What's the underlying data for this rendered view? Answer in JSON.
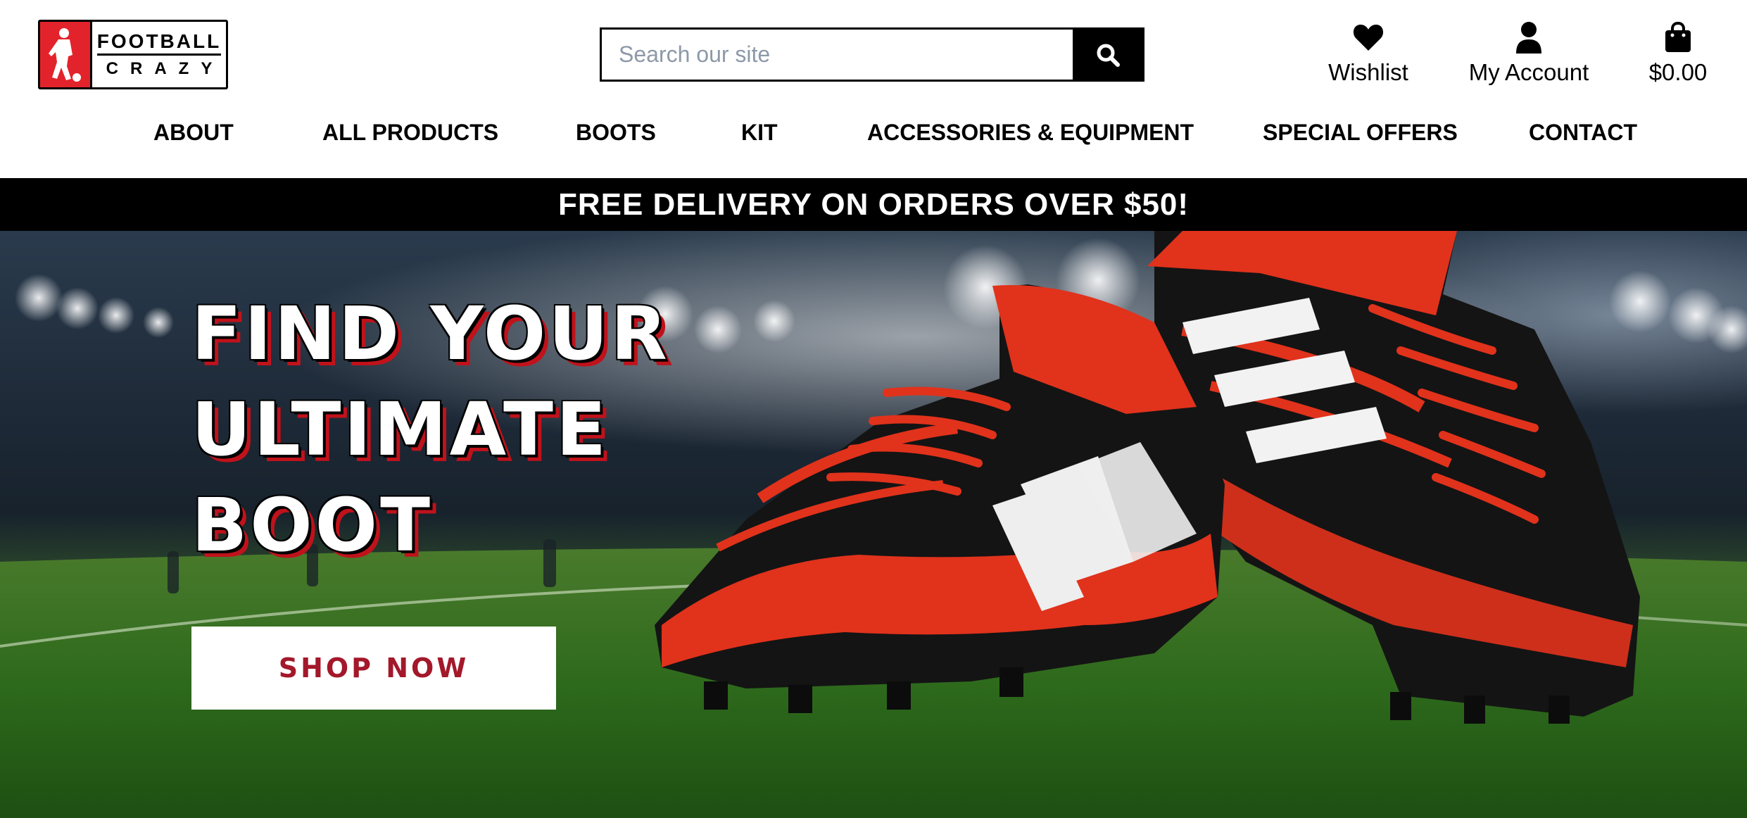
{
  "brand": {
    "line1": "FOOTBALL",
    "line2": "CRAZY",
    "accent_color": "#e3232b"
  },
  "search": {
    "placeholder": "Search our site",
    "value": "",
    "icon": "search-icon"
  },
  "utility": {
    "wishlist": {
      "label": "Wishlist",
      "icon": "heart-icon"
    },
    "account": {
      "label": "My Account",
      "icon": "user-icon"
    },
    "cart": {
      "label": "$0.00",
      "icon": "shopping-bag-icon"
    }
  },
  "nav": {
    "items": [
      {
        "label": "ABOUT"
      },
      {
        "label": "ALL PRODUCTS"
      },
      {
        "label": "BOOTS"
      },
      {
        "label": "KIT"
      },
      {
        "label": "ACCESSORIES & EQUIPMENT"
      },
      {
        "label": "SPECIAL OFFERS"
      },
      {
        "label": "CONTACT"
      }
    ]
  },
  "promo": {
    "text": "FREE DELIVERY ON ORDERS OVER $50!"
  },
  "hero": {
    "title_lines": [
      "FIND YOUR",
      "ULTIMATE",
      "BOOT"
    ],
    "cta_label": "SHOP NOW",
    "cta_color": "#a3182a"
  }
}
